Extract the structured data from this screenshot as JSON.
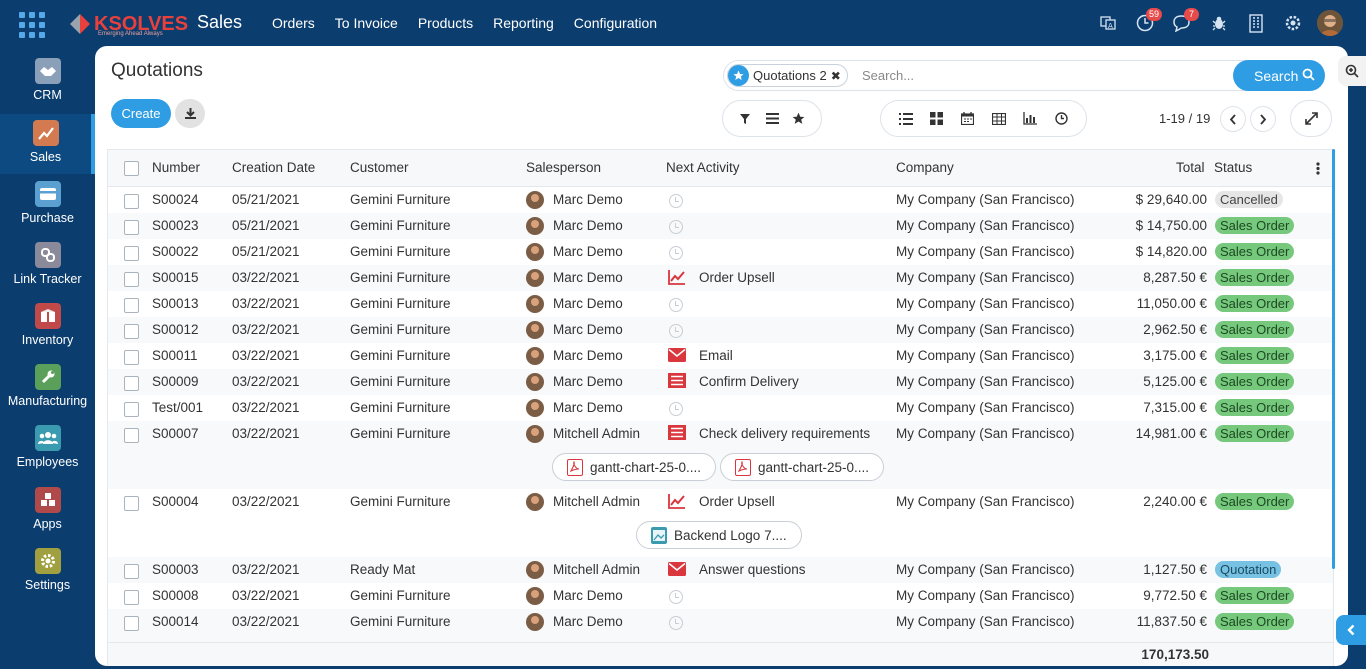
{
  "topbar": {
    "logo_text": "KSOLVES",
    "logo_tagline": "Emerging Ahead Always",
    "app_title": "Sales",
    "menu": [
      "Orders",
      "To Invoice",
      "Products",
      "Reporting",
      "Configuration"
    ],
    "activity_count": "59",
    "message_count": "7"
  },
  "sidebar": {
    "items": [
      {
        "label": "CRM",
        "icon": "handshake-icon",
        "color": "#8aa0b8"
      },
      {
        "label": "Sales",
        "icon": "chart-trend-icon",
        "color": "#d47a50"
      },
      {
        "label": "Purchase",
        "icon": "credit-card-icon",
        "color": "#5aa0d0"
      },
      {
        "label": "Link Tracker",
        "icon": "link-icon",
        "color": "#8a8a9a"
      },
      {
        "label": "Inventory",
        "icon": "box-icon",
        "color": "#c04a4a"
      },
      {
        "label": "Manufacturing",
        "icon": "wrench-icon",
        "color": "#5aa05a"
      },
      {
        "label": "Employees",
        "icon": "people-icon",
        "color": "#3a9ab0"
      },
      {
        "label": "Apps",
        "icon": "cubes-icon",
        "color": "#b04a4a"
      },
      {
        "label": "Settings",
        "icon": "gear-icon",
        "color": "#a0a040"
      }
    ]
  },
  "page": {
    "title": "Quotations",
    "create_label": "Create",
    "search_facet": "Quotations 2",
    "search_placeholder": "Search...",
    "search_button": "Search",
    "pager": "1-19 / 19"
  },
  "table": {
    "columns": [
      "Number",
      "Creation Date",
      "Customer",
      "Salesperson",
      "Next Activity",
      "Company",
      "Total",
      "Status"
    ],
    "rows": [
      {
        "number": "S00024",
        "date": "05/21/2021",
        "customer": "Gemini Furniture",
        "salesperson": "Marc Demo",
        "activity": "",
        "activity_type": "none",
        "company": "My Company (San Francisco)",
        "total": "$ 29,640.00",
        "status": "Cancelled",
        "status_type": "cancel"
      },
      {
        "number": "S00023",
        "date": "05/21/2021",
        "customer": "Gemini Furniture",
        "salesperson": "Marc Demo",
        "activity": "",
        "activity_type": "none",
        "company": "My Company (San Francisco)",
        "total": "$ 14,750.00",
        "status": "Sales Order",
        "status_type": "sales"
      },
      {
        "number": "S00022",
        "date": "05/21/2021",
        "customer": "Gemini Furniture",
        "salesperson": "Marc Demo",
        "activity": "",
        "activity_type": "none",
        "company": "My Company (San Francisco)",
        "total": "$ 14,820.00",
        "status": "Sales Order",
        "status_type": "sales"
      },
      {
        "number": "S00015",
        "date": "03/22/2021",
        "customer": "Gemini Furniture",
        "salesperson": "Marc Demo",
        "activity": "Order Upsell",
        "activity_type": "upsell",
        "company": "My Company (San Francisco)",
        "total": "8,287.50 €",
        "status": "Sales Order",
        "status_type": "sales"
      },
      {
        "number": "S00013",
        "date": "03/22/2021",
        "customer": "Gemini Furniture",
        "salesperson": "Marc Demo",
        "activity": "",
        "activity_type": "none",
        "company": "My Company (San Francisco)",
        "total": "11,050.00 €",
        "status": "Sales Order",
        "status_type": "sales"
      },
      {
        "number": "S00012",
        "date": "03/22/2021",
        "customer": "Gemini Furniture",
        "salesperson": "Marc Demo",
        "activity": "",
        "activity_type": "none",
        "company": "My Company (San Francisco)",
        "total": "2,962.50 €",
        "status": "Sales Order",
        "status_type": "sales"
      },
      {
        "number": "S00011",
        "date": "03/22/2021",
        "customer": "Gemini Furniture",
        "salesperson": "Marc Demo",
        "activity": "Email",
        "activity_type": "email",
        "company": "My Company (San Francisco)",
        "total": "3,175.00 €",
        "status": "Sales Order",
        "status_type": "sales"
      },
      {
        "number": "S00009",
        "date": "03/22/2021",
        "customer": "Gemini Furniture",
        "salesperson": "Marc Demo",
        "activity": "Confirm Delivery",
        "activity_type": "task",
        "company": "My Company (San Francisco)",
        "total": "5,125.00 €",
        "status": "Sales Order",
        "status_type": "sales"
      },
      {
        "number": "Test/001",
        "date": "03/22/2021",
        "customer": "Gemini Furniture",
        "salesperson": "Marc Demo",
        "activity": "",
        "activity_type": "none",
        "company": "My Company (San Francisco)",
        "total": "7,315.00 €",
        "status": "Sales Order",
        "status_type": "sales"
      },
      {
        "number": "S00007",
        "date": "03/22/2021",
        "customer": "Gemini Furniture",
        "salesperson": "Mitchell Admin",
        "activity": "Check delivery requirements",
        "activity_type": "task",
        "company": "My Company (San Francisco)",
        "total": "14,981.00 €",
        "status": "Sales Order",
        "status_type": "sales"
      },
      {
        "number": "S00004",
        "date": "03/22/2021",
        "customer": "Gemini Furniture",
        "salesperson": "Mitchell Admin",
        "activity": "Order Upsell",
        "activity_type": "upsell",
        "company": "My Company (San Francisco)",
        "total": "2,240.00 €",
        "status": "Sales Order",
        "status_type": "sales"
      },
      {
        "number": "S00003",
        "date": "03/22/2021",
        "customer": "Ready Mat",
        "salesperson": "Mitchell Admin",
        "activity": "Answer questions",
        "activity_type": "email",
        "company": "My Company (San Francisco)",
        "total": "1,127.50 €",
        "status": "Quotation",
        "status_type": "quote"
      },
      {
        "number": "S00008",
        "date": "03/22/2021",
        "customer": "Gemini Furniture",
        "salesperson": "Marc Demo",
        "activity": "",
        "activity_type": "none",
        "company": "My Company (San Francisco)",
        "total": "9,772.50 €",
        "status": "Sales Order",
        "status_type": "sales"
      },
      {
        "number": "S00014",
        "date": "03/22/2021",
        "customer": "Gemini Furniture",
        "salesperson": "Marc Demo",
        "activity": "",
        "activity_type": "none",
        "company": "My Company (San Francisco)",
        "total": "11,837.50 €",
        "status": "Sales Order",
        "status_type": "sales"
      }
    ],
    "attachments": {
      "s00007": [
        "gantt-chart-25-0....",
        "gantt-chart-25-0...."
      ],
      "s00004": [
        "Backend Logo 7...."
      ]
    },
    "grand_total": "170,173.50"
  },
  "colors": {
    "navbar": "#0b3d6e",
    "accent": "#2f9de4",
    "sales_order": "#76c87d",
    "quotation": "#77c2e3",
    "cancelled": "#e6e6e6",
    "activity_red": "#d9363e"
  }
}
